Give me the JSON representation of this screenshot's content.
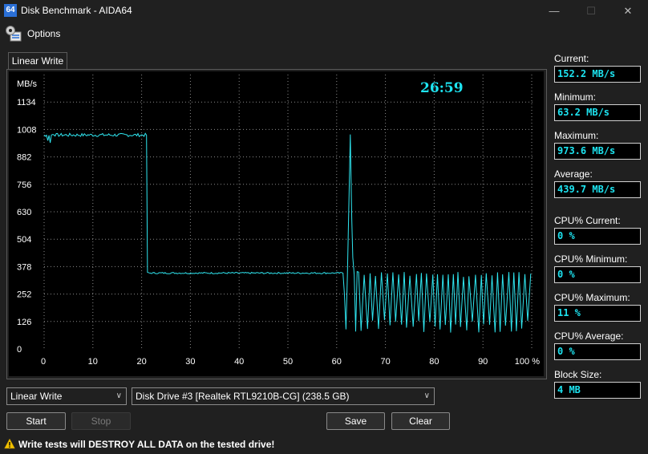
{
  "window": {
    "icon_text": "64",
    "title": "Disk Benchmark - AIDA64",
    "minimize": "—",
    "maximize": "☐",
    "close": "✕"
  },
  "menu": {
    "options_label": "Options"
  },
  "tabs": [
    {
      "label": "Linear Write"
    }
  ],
  "timer": "26:59",
  "chart_data": {
    "type": "line",
    "ylabel": "MB/s",
    "yticks": [
      0,
      126,
      252,
      378,
      504,
      630,
      756,
      882,
      1008,
      1134
    ],
    "xticks": [
      "0",
      "10",
      "20",
      "30",
      "40",
      "50",
      "60",
      "70",
      "80",
      "90",
      "100 %"
    ],
    "xlim": [
      0,
      100
    ],
    "ylim": [
      0,
      1260
    ],
    "grid": true,
    "line_color": "#2fe6f0",
    "segments": {
      "high": {
        "x_start": 0,
        "x_end": 21,
        "y_min": 975,
        "y_max": 990
      },
      "mid": {
        "x_start": 21,
        "x_end": 61.5,
        "y_min": 345,
        "y_max": 352
      },
      "spike": {
        "x": 62.8,
        "y": 985
      },
      "oscillation": {
        "x_start": 61.5,
        "x_end": 100,
        "y_low": 75,
        "y_high": 355
      }
    }
  },
  "stats": [
    {
      "label": "Current:",
      "value": "152.2 MB/s"
    },
    {
      "label": "Minimum:",
      "value": "63.2 MB/s"
    },
    {
      "label": "Maximum:",
      "value": "973.6 MB/s"
    },
    {
      "label": "Average:",
      "value": "439.7 MB/s"
    },
    {
      "label": "CPU% Current:",
      "value": "0 %"
    },
    {
      "label": "CPU% Minimum:",
      "value": "0 %"
    },
    {
      "label": "CPU% Maximum:",
      "value": "11 %"
    },
    {
      "label": "CPU% Average:",
      "value": "0 %"
    },
    {
      "label": "Block Size:",
      "value": "4 MB"
    }
  ],
  "controls": {
    "test_select": "Linear Write",
    "drive_select": "Disk Drive #3  [Realtek RTL9210B-CG]  (238.5 GB)",
    "start": "Start",
    "stop": "Stop",
    "save": "Save",
    "clear": "Clear"
  },
  "status": {
    "warning": "Write tests will DESTROY ALL DATA on the tested drive!"
  }
}
